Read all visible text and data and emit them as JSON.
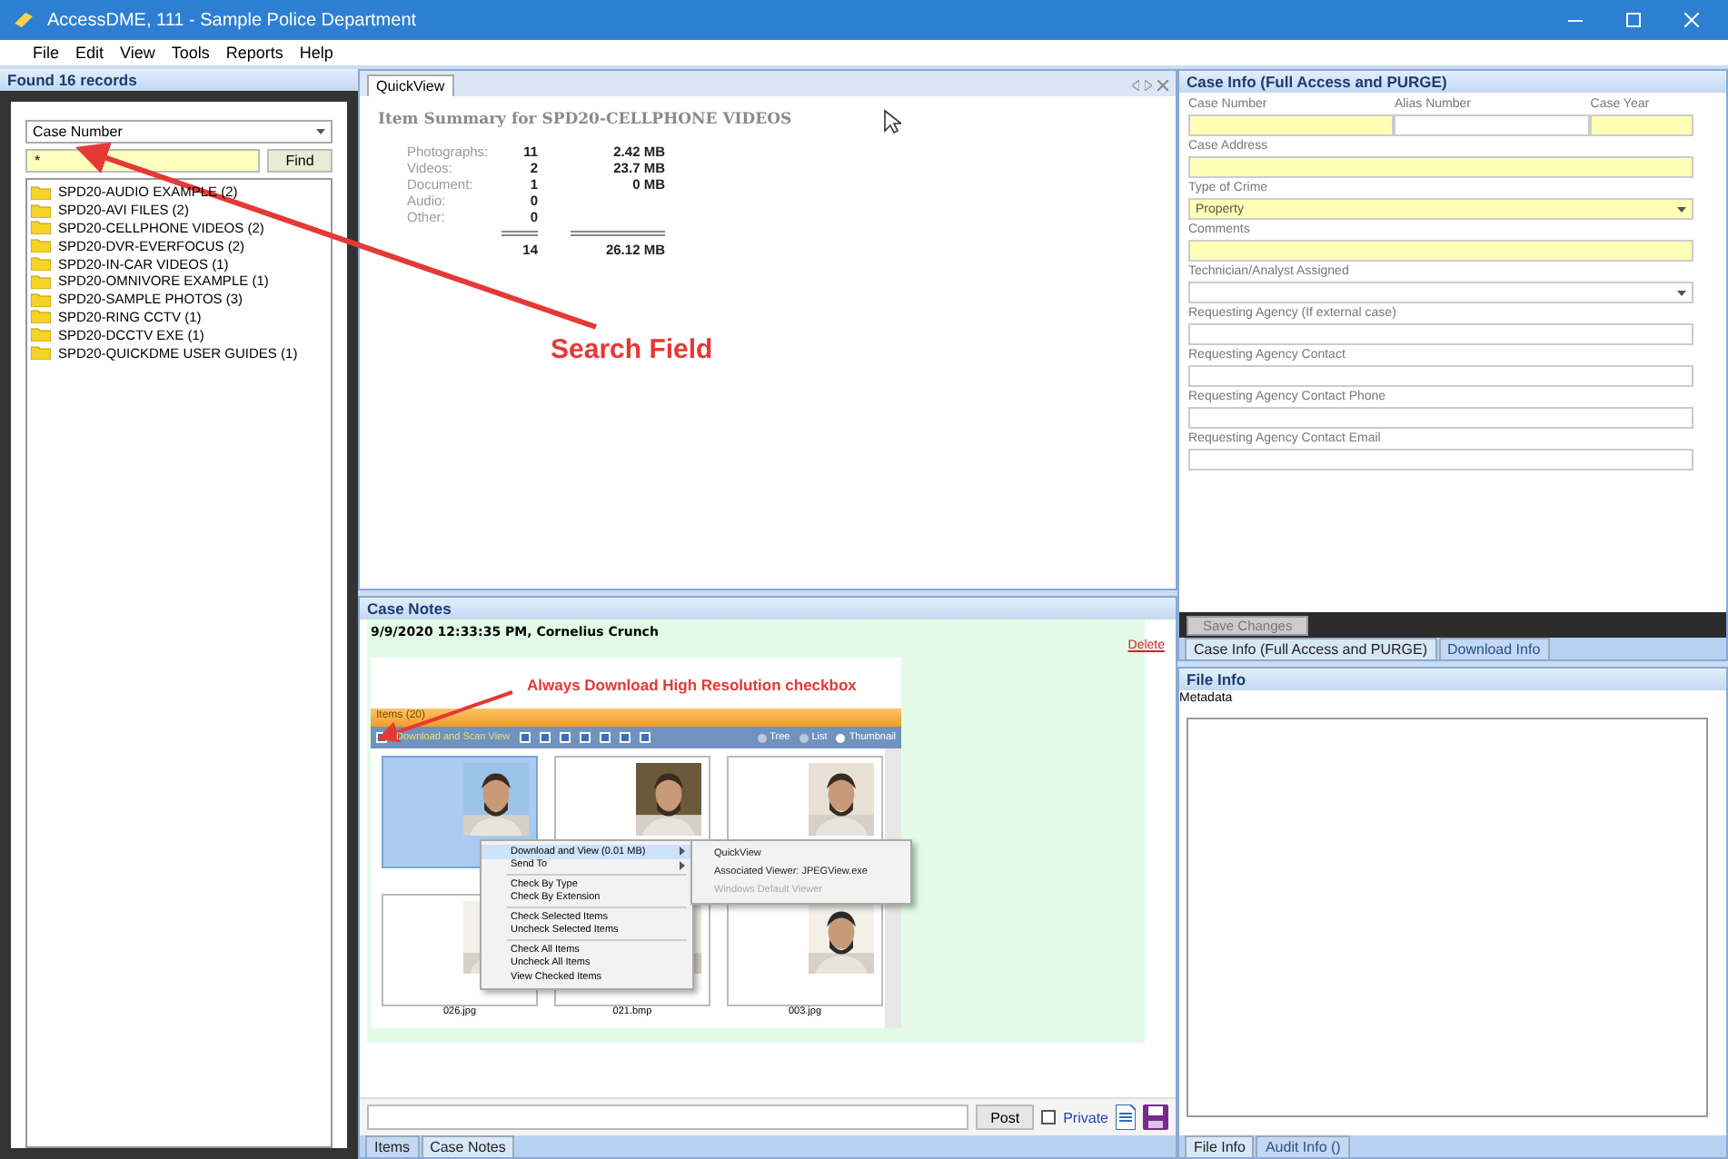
{
  "window": {
    "title": "AccessDME, 111 - Sample Police Department"
  },
  "menu": [
    "File",
    "Edit",
    "View",
    "Tools",
    "Reports",
    "Help"
  ],
  "records_panel": {
    "header": "Found 16 records",
    "search_by": "Case Number",
    "search_value": "*",
    "find_button": "Find",
    "cases": [
      {
        "label": "SPD20-AUDIO EXAMPLE (2)"
      },
      {
        "label": "SPD20-AVI FILES (2)"
      },
      {
        "label": "SPD20-CELLPHONE VIDEOS (2)"
      },
      {
        "label": "SPD20-DVR-EVERFOCUS (2)"
      },
      {
        "label": "SPD20-IN-CAR VIDEOS (1)"
      },
      {
        "label": "SPD20-OMNIVORE EXAMPLE (1)"
      },
      {
        "label": "SPD20-SAMPLE PHOTOS (3)"
      },
      {
        "label": "SPD20-RING CCTV (1)"
      },
      {
        "label": "SPD20-DCCTV EXE (1)"
      },
      {
        "label": "SPD20-QUICKDME USER GUIDES (1)"
      }
    ]
  },
  "annotation": {
    "text": "Search Field"
  },
  "quickview": {
    "tab": "QuickView",
    "title": "Item Summary for SPD20-CELLPHONE VIDEOS",
    "rows": [
      {
        "label": "Photographs:",
        "count": "11",
        "size": "2.42 MB"
      },
      {
        "label": "Videos:",
        "count": "2",
        "size": "23.7 MB"
      },
      {
        "label": "Document:",
        "count": "1",
        "size": "0 MB"
      },
      {
        "label": "Audio:",
        "count": "0"
      },
      {
        "label": "Other:",
        "count": "0"
      }
    ],
    "total_count": "14",
    "total_size": "26.12 MB"
  },
  "case_notes": {
    "header": "Case Notes",
    "note_header": "9/9/2020 12:33:35 PM, Cornelius Crunch",
    "delete_link": "Delete",
    "screenshot": {
      "callout": "Always Download High Resolution checkbox",
      "panel_title": "Items (20)",
      "hi_res": {
        "label": "Download and Scan View",
        "checked": true
      },
      "type_filters": [
        {
          "checked": true
        },
        {
          "checked": true
        },
        {
          "checked": true
        },
        {
          "checked": true
        },
        {
          "checked": true
        },
        {
          "checked": true
        },
        {
          "checked": true
        }
      ],
      "views": [
        {
          "label": "Tree",
          "selected": false
        },
        {
          "label": "List",
          "selected": false
        },
        {
          "label": "Thumbnail",
          "selected": true
        }
      ],
      "thumbnails": [
        {
          "selected": true
        },
        {
          "selected": false
        },
        {
          "selected": false
        },
        {
          "selected": false,
          "file": "026.jpg"
        },
        {
          "selected": false,
          "file": "021.bmp"
        },
        {
          "selected": false,
          "file": "003.jpg"
        }
      ],
      "context_menu": [
        [
          {
            "label": "Download and View (0.01 MB)",
            "submenu": true,
            "highlighted": true
          },
          {
            "label": "Send To",
            "submenu": true,
            "highlighted": false
          }
        ],
        [
          {
            "label": "Check By Type",
            "submenu": false,
            "highlighted": false
          },
          {
            "label": "Check By Extension",
            "submenu": false,
            "highlighted": false
          }
        ],
        [
          {
            "label": "Check Selected Items",
            "submenu": false,
            "highlighted": false
          },
          {
            "label": "Uncheck Selected Items",
            "submenu": false,
            "highlighted": false
          }
        ],
        [
          {
            "label": "Check All Items",
            "submenu": false,
            "highlighted": false
          },
          {
            "label": "Uncheck All Items",
            "submenu": false,
            "highlighted": false
          },
          {
            "label": "View Checked Items",
            "submenu": false,
            "highlighted": false
          }
        ]
      ],
      "submenu": [
        {
          "label": "QuickView",
          "disabled": false
        },
        {
          "label": "Associated Viewer: JPEGView.exe",
          "disabled": false
        },
        {
          "label": "Windows Default Viewer",
          "disabled": true
        }
      ]
    },
    "post_button": "Post",
    "private": {
      "label": "Private",
      "checked": false
    }
  },
  "middle_tabs": [
    {
      "label": "Items",
      "selected": false
    },
    {
      "label": "Case Notes",
      "selected": true
    }
  ],
  "case_info": {
    "header": "Case Info (Full Access and PURGE)",
    "rows": [
      [
        {
          "label": "Case Number",
          "kind": "text",
          "required": true
        },
        {
          "label": "Alias Number",
          "kind": "text",
          "required": false
        },
        {
          "label": "Case Year",
          "kind": "text",
          "required": true
        }
      ],
      [
        {
          "label": "Case Address",
          "kind": "text",
          "required": true
        }
      ],
      [
        {
          "label": "Type of Crime",
          "kind": "select",
          "required": true,
          "value": "Property"
        }
      ],
      [
        {
          "label": "Comments",
          "kind": "text",
          "required": true
        }
      ],
      [
        {
          "label": "Technician/Analyst Assigned",
          "kind": "select",
          "required": false
        }
      ],
      [
        {
          "label": "Requesting Agency (If external case)",
          "kind": "text",
          "required": false
        }
      ],
      [
        {
          "label": "Requesting Agency Contact",
          "kind": "text",
          "required": false
        }
      ],
      [
        {
          "label": "Requesting Agency Contact Phone",
          "kind": "text",
          "required": false
        }
      ],
      [
        {
          "label": "Requesting Agency Contact Email",
          "kind": "text",
          "required": false
        }
      ]
    ],
    "save_button": {
      "label": "Save Changes",
      "disabled": true
    }
  },
  "case_info_tabs": [
    {
      "label": "Case Info (Full Access and PURGE)",
      "selected": true
    },
    {
      "label": "Download Info",
      "selected": false
    }
  ],
  "file_info": {
    "header": "File Info",
    "label": "Metadata"
  },
  "file_info_tabs": [
    {
      "label": "File Info",
      "selected": true
    },
    {
      "label": "Audit Info ()",
      "selected": false
    }
  ]
}
